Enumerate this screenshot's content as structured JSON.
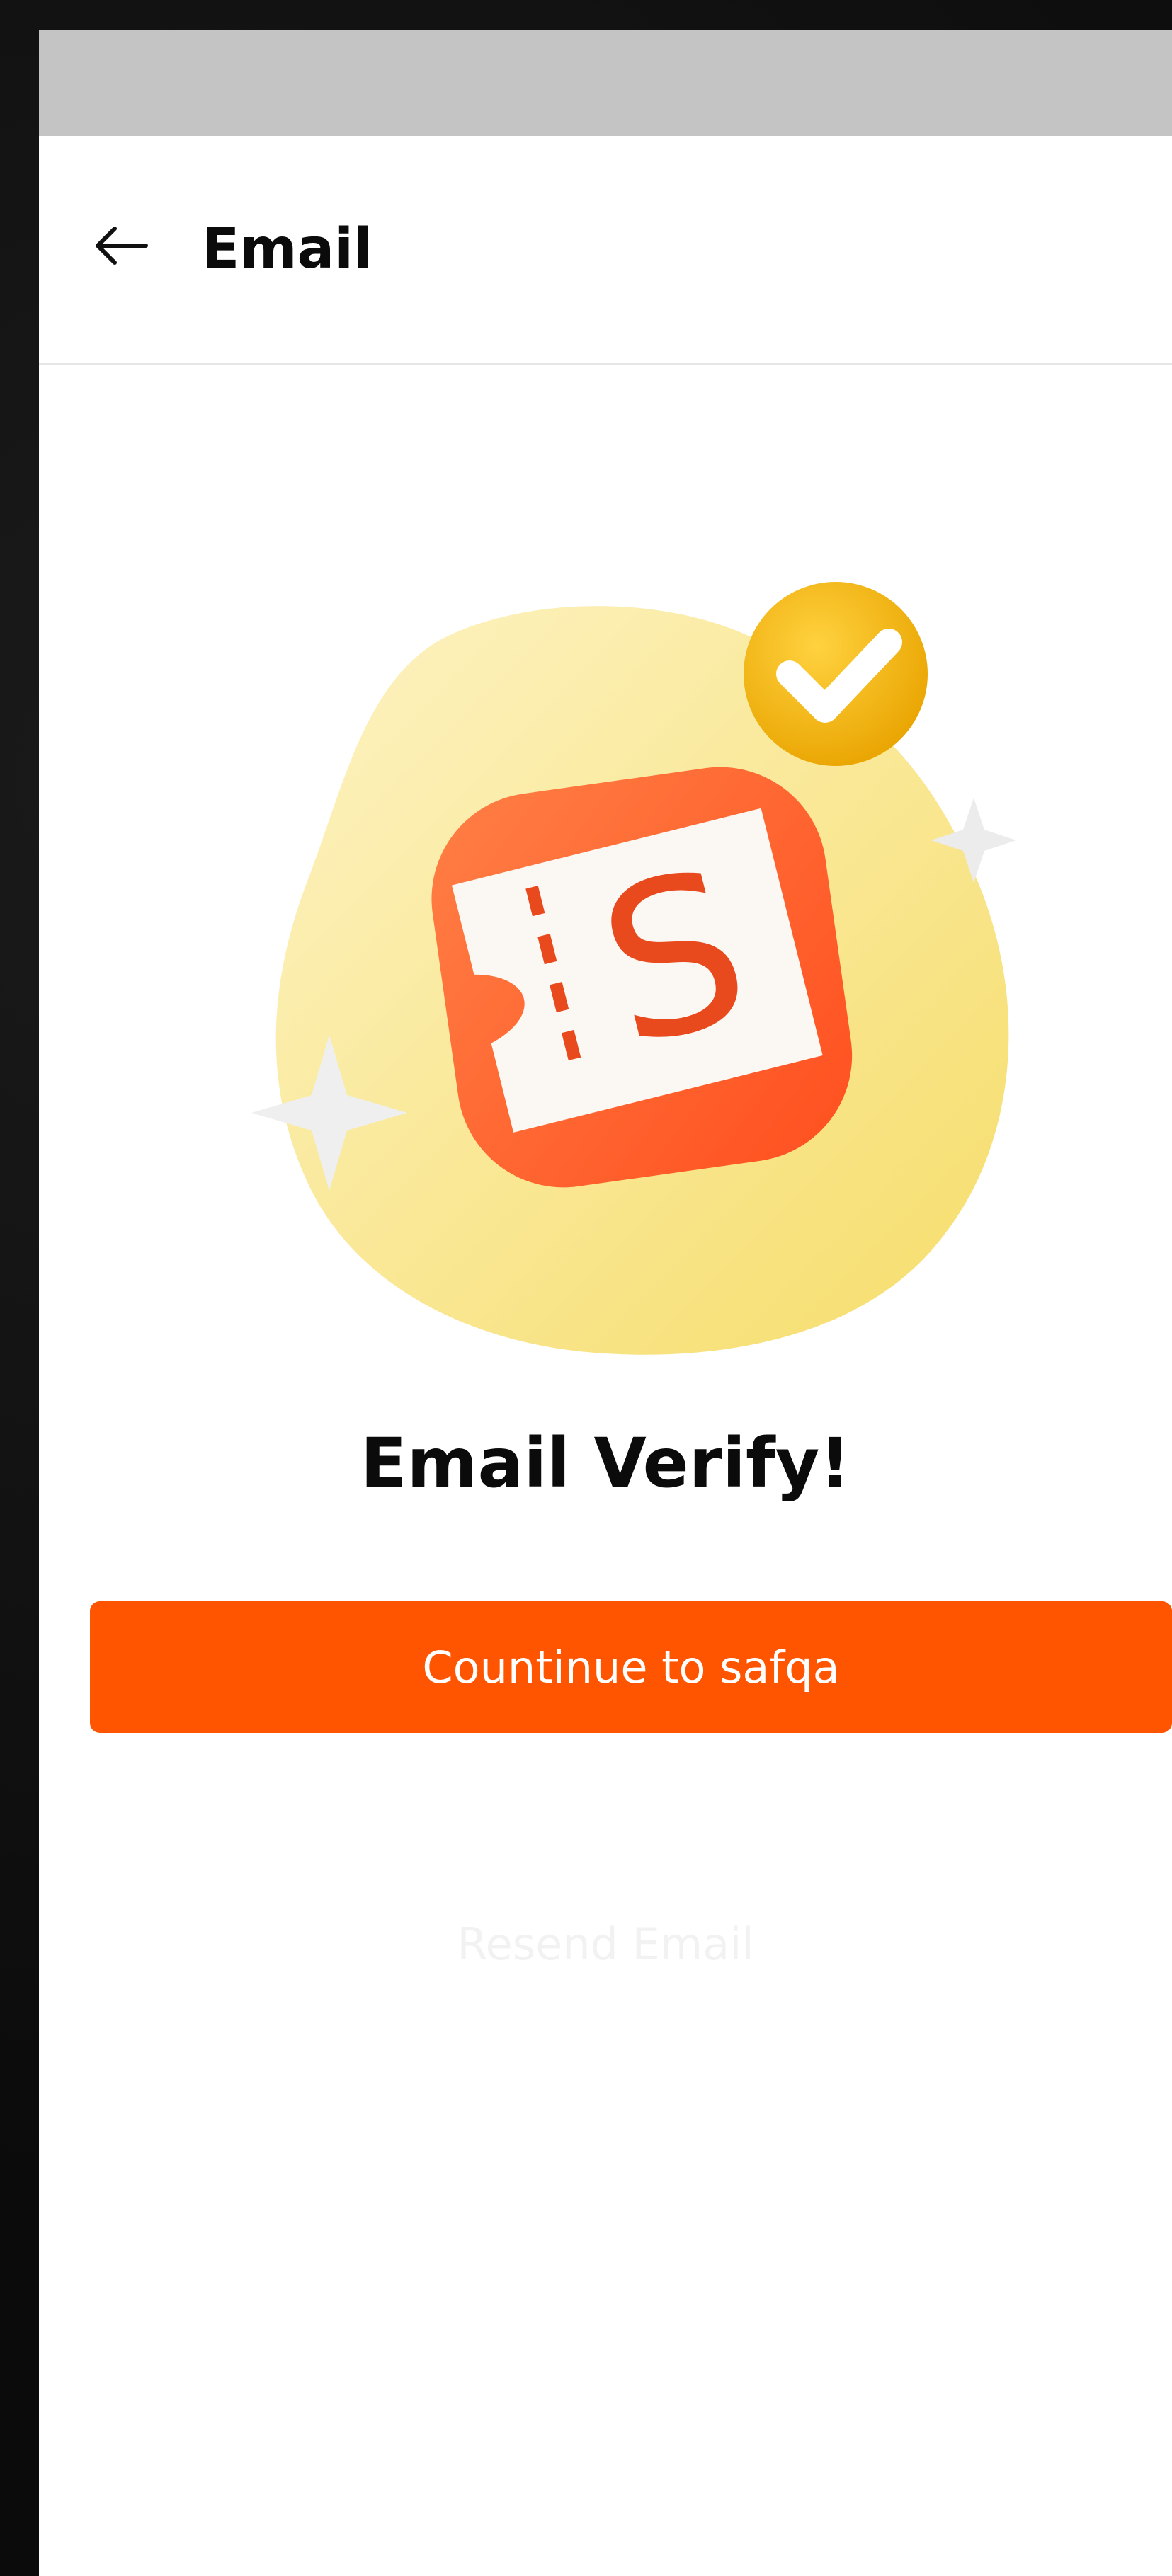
{
  "header": {
    "title": "Email",
    "back_icon": "arrow-left-icon"
  },
  "illustration": {
    "icon": "safqa-ticket-verified-icon",
    "letter": "S",
    "colors": {
      "blob": "#f8e27a",
      "tile": "#ff6a2c",
      "badge": "#f4b400",
      "ticket": "#fbf7f2"
    }
  },
  "content": {
    "headline": "Email Verify!",
    "continue_label": "Countinue to safqa",
    "resend_label": "Resend Email"
  },
  "colors": {
    "accent": "#ff5500",
    "status_bar": "#c4c4c4"
  }
}
